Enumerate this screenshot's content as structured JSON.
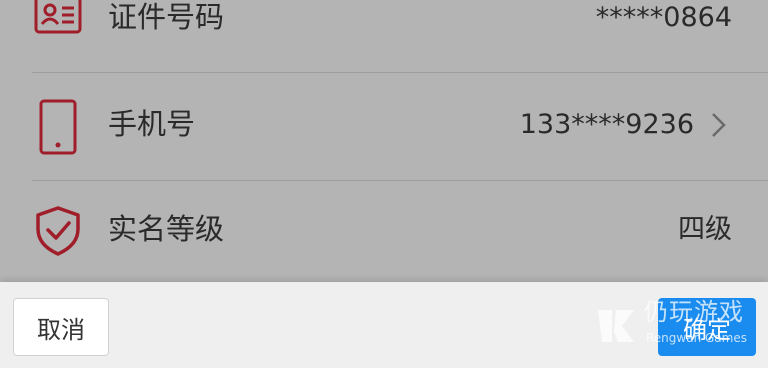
{
  "rows": [
    {
      "icon": "id-card-icon",
      "label": "证件号码",
      "value": "*****0864"
    },
    {
      "icon": "mobile-phone-icon",
      "label": "手机号",
      "value": "133****9236",
      "chevron": "chevron-right-icon"
    },
    {
      "icon": "shield-check-icon",
      "label": "实名等级",
      "value": "四级"
    }
  ],
  "actions": {
    "cancel_label": "取消",
    "confirm_label": "确定"
  },
  "watermark": {
    "title": "仍玩游戏",
    "subtitle": "Rengwan Games"
  },
  "colors": {
    "icon_red": "#a01e2a",
    "confirm_blue": "#1a8cf0",
    "overlay_gray": "#b4b4b4"
  }
}
